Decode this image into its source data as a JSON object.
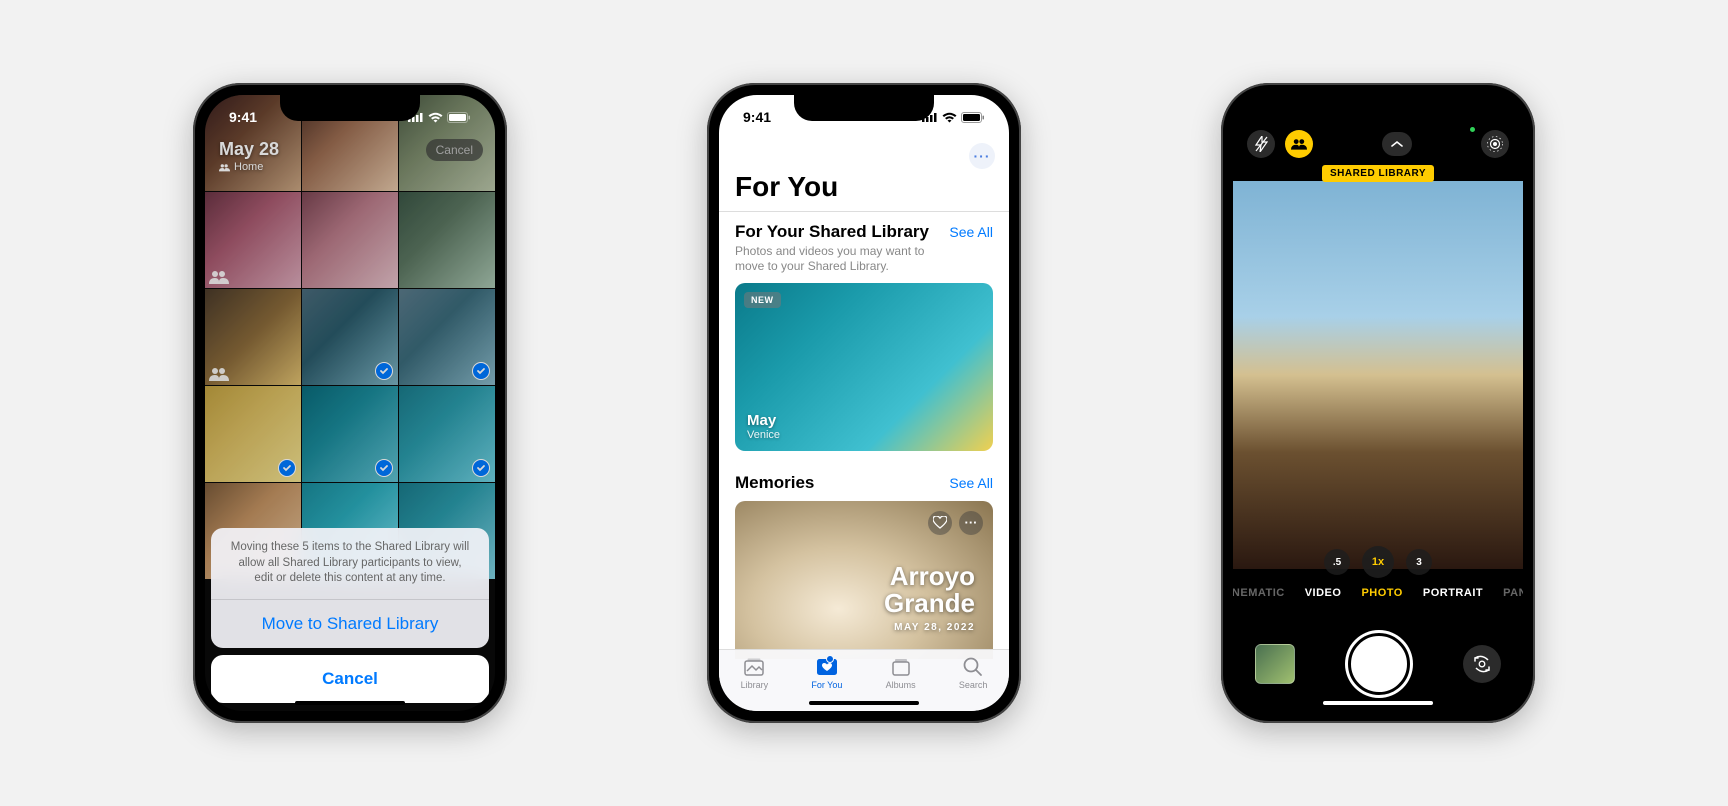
{
  "status": {
    "time": "9:41"
  },
  "phone1": {
    "date": "May 28",
    "location_label": "Home",
    "top_cancel": "Cancel",
    "sheet_message": "Moving these 5 items to the Shared Library will allow all Shared Library participants to view, edit or delete this content at any time.",
    "sheet_action": "Move to Shared Library",
    "sheet_cancel": "Cancel",
    "selected": [
      false,
      false,
      false,
      false,
      false,
      false,
      false,
      true,
      true,
      false,
      true,
      true,
      false,
      false,
      false
    ]
  },
  "phone2": {
    "title": "For You",
    "section1": {
      "title": "For Your Shared Library",
      "see_all": "See All",
      "subtitle": "Photos and videos you may want to move to your Shared Library.",
      "badge": "NEW",
      "card_title": "May",
      "card_sub": "Venice"
    },
    "section2": {
      "title": "Memories",
      "see_all": "See All",
      "mem_title_line1": "Arroyo",
      "mem_title_line2": "Grande",
      "mem_date": "MAY 28, 2022"
    },
    "tabs": {
      "library": "Library",
      "foryou": "For You",
      "albums": "Albums",
      "search": "Search"
    }
  },
  "phone3": {
    "shared_badge": "SHARED LIBRARY",
    "zoom": {
      "z05": ".5",
      "z1": "1x",
      "z3": "3"
    },
    "modes": {
      "cinematic": "CINEMATIC",
      "video": "VIDEO",
      "photo": "PHOTO",
      "portrait": "PORTRAIT",
      "pano": "PANO"
    }
  }
}
